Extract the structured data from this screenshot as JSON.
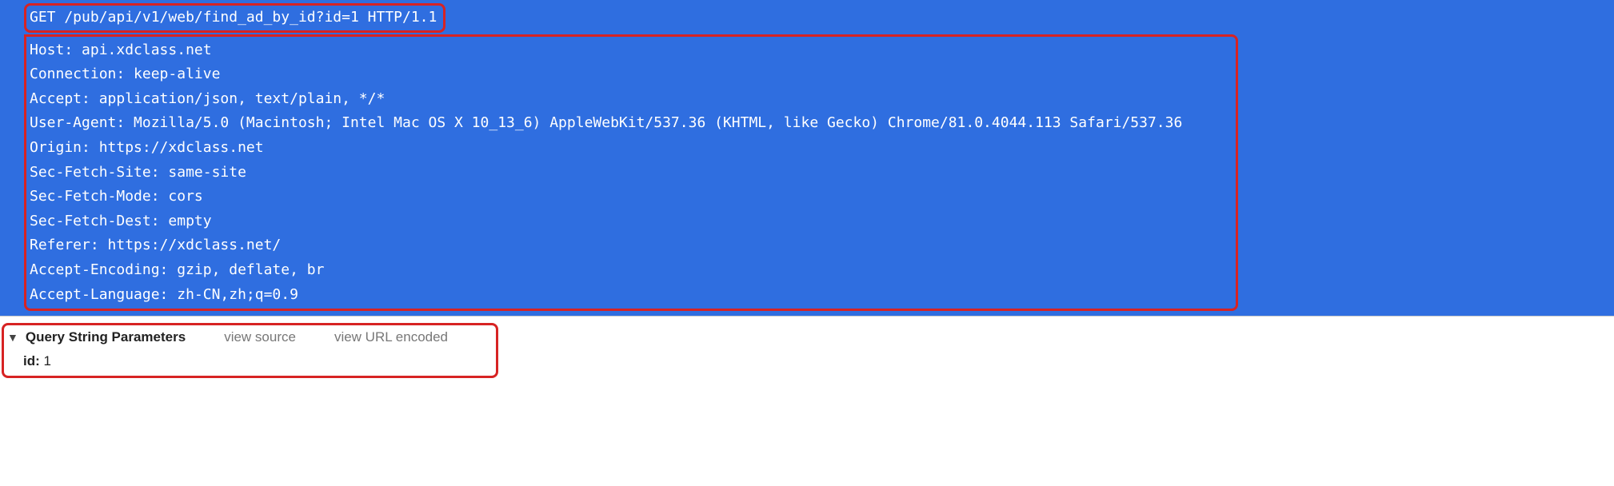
{
  "request_line": "GET /pub/api/v1/web/find_ad_by_id?id=1 HTTP/1.1",
  "headers": {
    "host": "Host: api.xdclass.net",
    "connection": "Connection: keep-alive",
    "accept": "Accept: application/json, text/plain, */*",
    "user_agent": "User-Agent: Mozilla/5.0 (Macintosh; Intel Mac OS X 10_13_6) AppleWebKit/537.36 (KHTML, like Gecko) Chrome/81.0.4044.113 Safari/537.36",
    "origin": "Origin: https://xdclass.net",
    "sec_fetch_site": "Sec-Fetch-Site: same-site",
    "sec_fetch_mode": "Sec-Fetch-Mode: cors",
    "sec_fetch_dest": "Sec-Fetch-Dest: empty",
    "referer": "Referer: https://xdclass.net/",
    "accept_encoding": "Accept-Encoding: gzip, deflate, br",
    "accept_language": "Accept-Language: zh-CN,zh;q=0.9"
  },
  "params": {
    "section_title": "Query String Parameters",
    "view_source": "view source",
    "view_url_encoded": "view URL encoded",
    "items": [
      {
        "key": "id:",
        "value": "1"
      }
    ]
  }
}
